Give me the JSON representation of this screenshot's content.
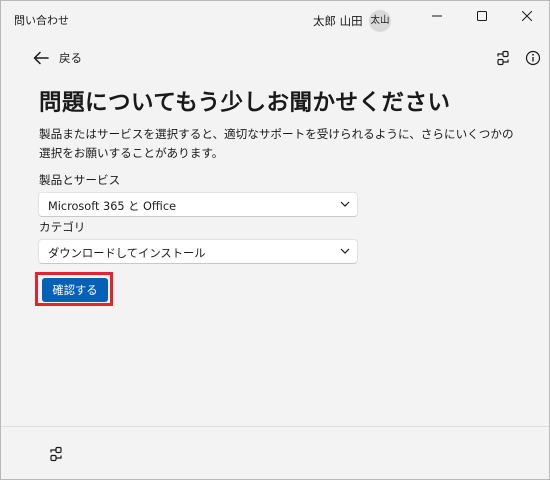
{
  "window": {
    "title": "問い合わせ",
    "user_name": "太郎 山田",
    "avatar_text": "太山"
  },
  "header": {
    "back_label": "戻る",
    "icons": [
      "connect-icon",
      "info-icon"
    ]
  },
  "main": {
    "heading": "問題についてもう少しお聞かせください",
    "description": "製品またはサービスを選択すると、適切なサポートを受けられるように、さらにいくつかの選択をお願いすることがあります。",
    "product_label": "製品とサービス",
    "product_value": "Microsoft 365 と Office",
    "category_label": "カテゴリ",
    "category_value": "ダウンロードしてインストール",
    "confirm_label": "確認する"
  },
  "colors": {
    "accent": "#0560b8",
    "highlight": "#e0252f",
    "background": "#f3f3f3"
  },
  "footer": {
    "icons": [
      "connect-icon"
    ]
  }
}
